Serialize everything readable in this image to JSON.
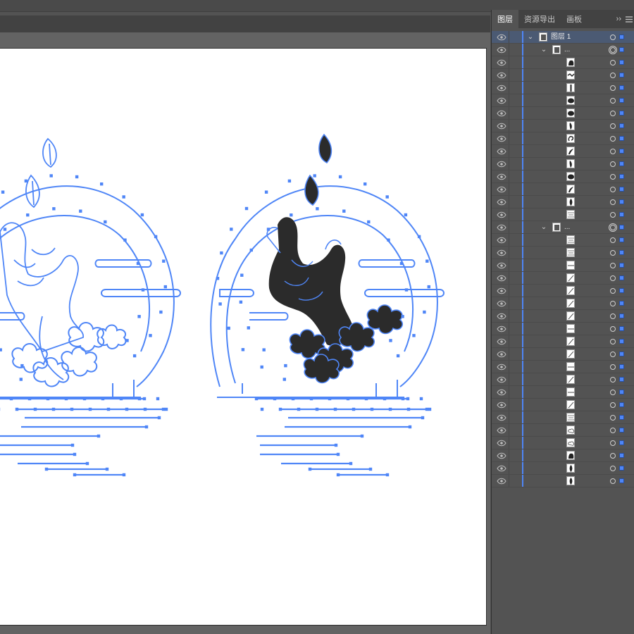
{
  "colors": {
    "ui_background": "#535353",
    "canvas_background": "#636363",
    "artboard": "#ffffff",
    "selection_blue": "#4f86f7",
    "fill_dark": "#2b2b2b"
  },
  "panel": {
    "tabs": [
      {
        "label": "图层",
        "active": true
      },
      {
        "label": "资源导出",
        "active": false
      },
      {
        "label": "画板",
        "active": false
      }
    ],
    "collapse_label": "››",
    "menu_icon": "hamburger-menu-icon"
  },
  "layers": [
    {
      "depth": 0,
      "expand": "open",
      "name": "图层 1",
      "thumb": "group",
      "selected": true
    },
    {
      "depth": 1,
      "expand": "open",
      "name": "...",
      "thumb": "group",
      "double_target": true
    },
    {
      "depth": 2,
      "expand": "closed",
      "name": "",
      "thumb": "hand"
    },
    {
      "depth": 2,
      "expand": "none",
      "name": "",
      "thumb": "stroke"
    },
    {
      "depth": 2,
      "expand": "none",
      "name": "",
      "thumb": "bar"
    },
    {
      "depth": 2,
      "expand": "none",
      "name": "",
      "thumb": "blob"
    },
    {
      "depth": 2,
      "expand": "none",
      "name": "",
      "thumb": "blob"
    },
    {
      "depth": 2,
      "expand": "none",
      "name": "",
      "thumb": "tall"
    },
    {
      "depth": 2,
      "expand": "none",
      "name": "",
      "thumb": "curl"
    },
    {
      "depth": 2,
      "expand": "none",
      "name": "",
      "thumb": "hook"
    },
    {
      "depth": 2,
      "expand": "none",
      "name": "",
      "thumb": "tall"
    },
    {
      "depth": 2,
      "expand": "none",
      "name": "",
      "thumb": "blob"
    },
    {
      "depth": 2,
      "expand": "none",
      "name": "",
      "thumb": "hook"
    },
    {
      "depth": 2,
      "expand": "none",
      "name": "",
      "thumb": "leaf"
    },
    {
      "depth": 2,
      "expand": "closed",
      "name": "",
      "thumb": "lines"
    },
    {
      "depth": 1,
      "expand": "open",
      "name": "...",
      "thumb": "group",
      "double_target": true
    },
    {
      "depth": 2,
      "expand": "closed",
      "name": "",
      "thumb": "lines"
    },
    {
      "depth": 2,
      "expand": "closed",
      "name": "",
      "thumb": "lines"
    },
    {
      "depth": 2,
      "expand": "closed",
      "name": "",
      "thumb": "line"
    },
    {
      "depth": 2,
      "expand": "none",
      "name": "",
      "thumb": "diag"
    },
    {
      "depth": 2,
      "expand": "none",
      "name": "",
      "thumb": "diag"
    },
    {
      "depth": 2,
      "expand": "none",
      "name": "",
      "thumb": "diag"
    },
    {
      "depth": 2,
      "expand": "none",
      "name": "",
      "thumb": "diag"
    },
    {
      "depth": 2,
      "expand": "none",
      "name": "",
      "thumb": "line"
    },
    {
      "depth": 2,
      "expand": "none",
      "name": "",
      "thumb": "diag"
    },
    {
      "depth": 2,
      "expand": "none",
      "name": "",
      "thumb": "diag"
    },
    {
      "depth": 2,
      "expand": "none",
      "name": "",
      "thumb": "line"
    },
    {
      "depth": 2,
      "expand": "none",
      "name": "",
      "thumb": "diag"
    },
    {
      "depth": 2,
      "expand": "none",
      "name": "",
      "thumb": "line"
    },
    {
      "depth": 2,
      "expand": "none",
      "name": "",
      "thumb": "diag"
    },
    {
      "depth": 2,
      "expand": "closed",
      "name": "",
      "thumb": "lines"
    },
    {
      "depth": 2,
      "expand": "closed",
      "name": "",
      "thumb": "cloud"
    },
    {
      "depth": 2,
      "expand": "closed",
      "name": "",
      "thumb": "cloud"
    },
    {
      "depth": 2,
      "expand": "closed",
      "name": "",
      "thumb": "hand"
    },
    {
      "depth": 2,
      "expand": "closed",
      "name": "",
      "thumb": "leaf"
    },
    {
      "depth": 2,
      "expand": "closed",
      "name": "",
      "thumb": "leaf"
    }
  ]
}
